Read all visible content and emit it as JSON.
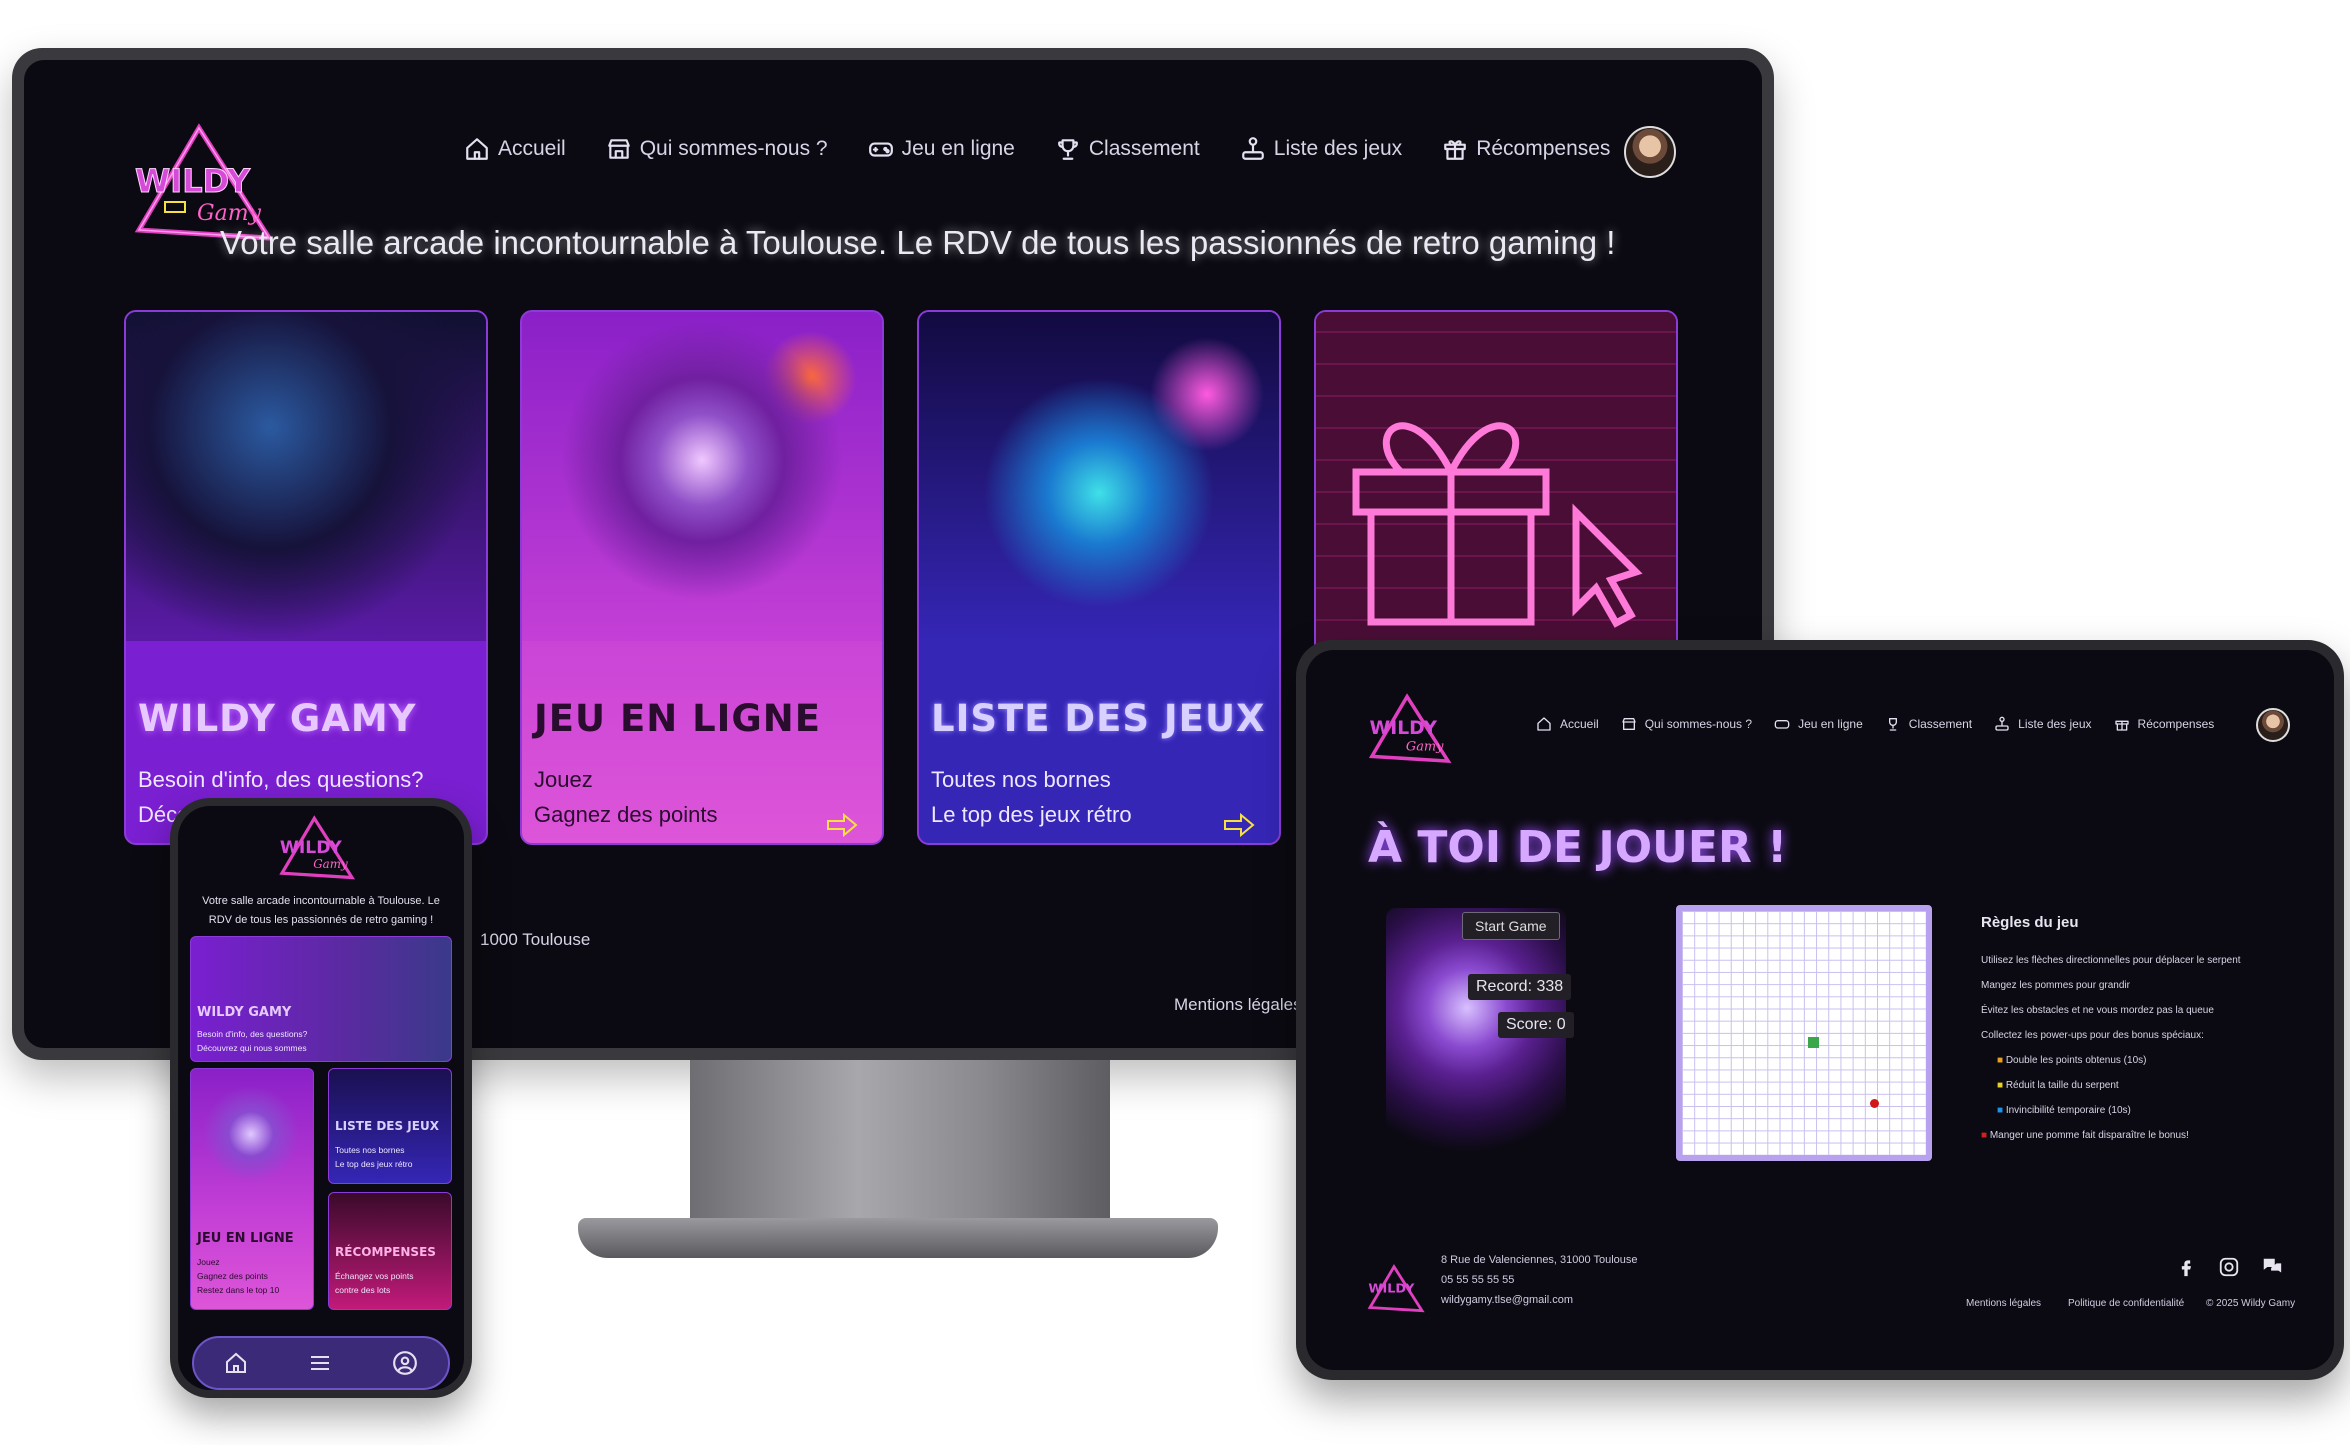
{
  "brand": {
    "logo_line1": "WILDY",
    "logo_line2": "Gamy"
  },
  "nav": [
    "Accueil",
    "Qui sommes-nous ?",
    "Jeu en ligne",
    "Classement",
    "Liste des jeux",
    "Récompenses"
  ],
  "desktop": {
    "tagline": "Votre salle arcade incontournable à Toulouse. Le RDV de tous les passionnés de retro gaming !",
    "cards": [
      {
        "title": "WILDY GAMY",
        "line1": "Besoin d'info, des questions?",
        "line2": "Découvrez qui nous sommes",
        "color": "#7a1fd1"
      },
      {
        "title": "JEU EN LIGNE",
        "line1": "Jouez",
        "line2": "Gagnez des points",
        "color": "#c43fd6"
      },
      {
        "title": "LISTE DES JEUX",
        "line1": "Toutes nos bornes",
        "line2": "Le top des jeux rétro",
        "color": "#3526b6"
      },
      {
        "title": "RÉCOMPENSES",
        "line1": "Échangez vos points",
        "line2": "contre des lots",
        "color": "#c21a7a"
      }
    ],
    "footer_address": "1000 Toulouse",
    "footer_mentions": "Mentions légales"
  },
  "tablet": {
    "title": "À TOI DE JOUER !",
    "start_button": "Start Game",
    "record": "Record: 338",
    "score": "Score: 0",
    "rules": {
      "heading": "Règles du jeu",
      "lines": [
        "Utilisez les flèches directionnelles pour déplacer le serpent",
        "Mangez les pommes pour grandir",
        "Évitez les obstacles et ne vous mordez pas la queue",
        "Collectez les power-ups pour des bonus spéciaux:",
        "Double les points obtenus (10s)",
        "Réduit la taille du serpent",
        "Invincibilité temporaire (10s)",
        "Manger une pomme fait disparaître le bonus!"
      ],
      "powerup_colors": [
        "#e8a020",
        "#e8d020",
        "#2090e8",
        "#d02020"
      ]
    },
    "board": {
      "snake_color": "#3aa84a",
      "apple_color": "#d01818"
    },
    "footer": {
      "address": "8 Rue de Valenciennes, 31000 Toulouse",
      "phone": "05 55 55 55 55",
      "email": "wildygamy.tlse@gmail.com",
      "links": [
        "Mentions légales",
        "Politique de confidentialité",
        "© 2025 Wildy Gamy"
      ]
    }
  },
  "phone": {
    "tagline": "Votre salle arcade incontournable à Toulouse. Le RDV de tous les passionnés de retro gaming !",
    "cards": [
      {
        "title": "WILDY GAMY",
        "line1": "Besoin d'info, des questions?",
        "line2": "Découvrez qui nous sommes"
      },
      {
        "title": "JEU EN LIGNE",
        "line1": "Jouez",
        "line2": "Gagnez des points",
        "line3": "Restez dans le top 10"
      },
      {
        "title": "LISTE DES JEUX",
        "line1": "Toutes nos bornes",
        "line2": "Le top des jeux rétro"
      },
      {
        "title": "RÉCOMPENSES",
        "line1": "Échangez vos points",
        "line2": "contre des lots"
      }
    ]
  }
}
